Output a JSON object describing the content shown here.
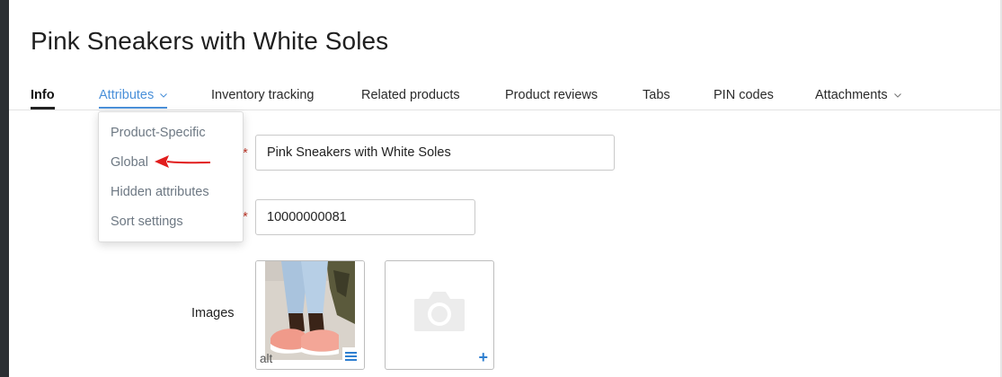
{
  "page": {
    "title": "Pink Sneakers with White Soles"
  },
  "tabs": [
    {
      "label": "Info"
    },
    {
      "label": "Attributes"
    },
    {
      "label": "Inventory tracking"
    },
    {
      "label": "Related products"
    },
    {
      "label": "Product reviews"
    },
    {
      "label": "Tabs"
    },
    {
      "label": "PIN codes"
    },
    {
      "label": "Attachments"
    }
  ],
  "attributes_menu": {
    "items": [
      {
        "label": "Product-Specific"
      },
      {
        "label": "Global"
      },
      {
        "label": "Hidden attributes"
      },
      {
        "label": "Sort settings"
      }
    ]
  },
  "form": {
    "name_value": "Pink Sneakers with White Soles",
    "code_value": "10000000081",
    "required_mark": "*",
    "images_label": "Images",
    "image_alt_tag": "alt",
    "add_image_symbol": "+"
  },
  "colors": {
    "accent": "#4a90d9",
    "arrow": "#e11d1d",
    "required": "#c0392b",
    "sidebar": "#2b2f33"
  },
  "icons": {
    "tab_caret": "chevron-down-icon",
    "image_menu": "menu-lines-icon",
    "image_placeholder": "camera-icon",
    "add_image": "plus-icon",
    "annotation": "red-arrow-icon"
  }
}
